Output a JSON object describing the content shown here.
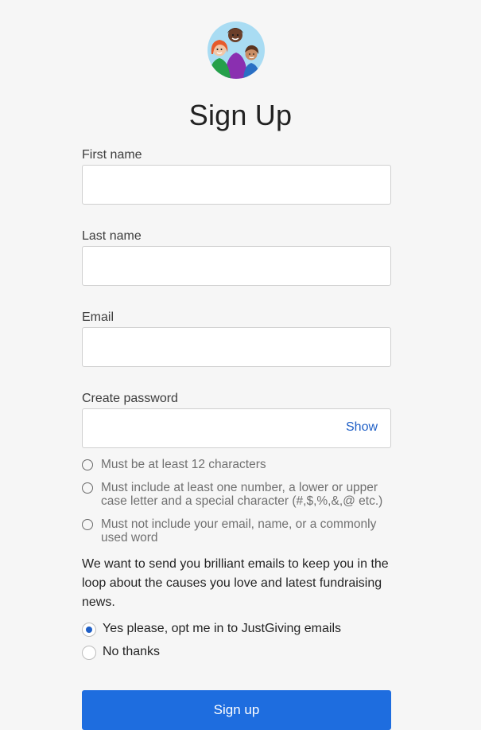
{
  "header": {
    "logo_icon": "family-avatar-icon",
    "title": "Sign Up"
  },
  "form": {
    "first_name": {
      "label": "First name",
      "value": ""
    },
    "last_name": {
      "label": "Last name",
      "value": ""
    },
    "email": {
      "label": "Email",
      "value": ""
    },
    "password": {
      "label": "Create password",
      "value": "",
      "show_label": "Show"
    },
    "password_rules": [
      {
        "text": "Must be at least 12 characters",
        "met": false
      },
      {
        "text": "Must include at least one number, a lower or upper case letter and a special character (#,$,%,&,@ etc.)",
        "met": false
      },
      {
        "text": "Must not include your email, name, or a commonly used word",
        "met": false
      }
    ],
    "marketing_text": "We want to send you brilliant emails to keep you in the loop about the causes you love and latest fundraising news.",
    "marketing_options": [
      {
        "label": "Yes please, opt me in to JustGiving emails",
        "selected": true
      },
      {
        "label": "No thanks",
        "selected": false
      }
    ],
    "submit_label": "Sign up"
  },
  "colors": {
    "accent": "#1e6ddf",
    "link": "#1f5fc6",
    "background": "#f6f6f6"
  }
}
